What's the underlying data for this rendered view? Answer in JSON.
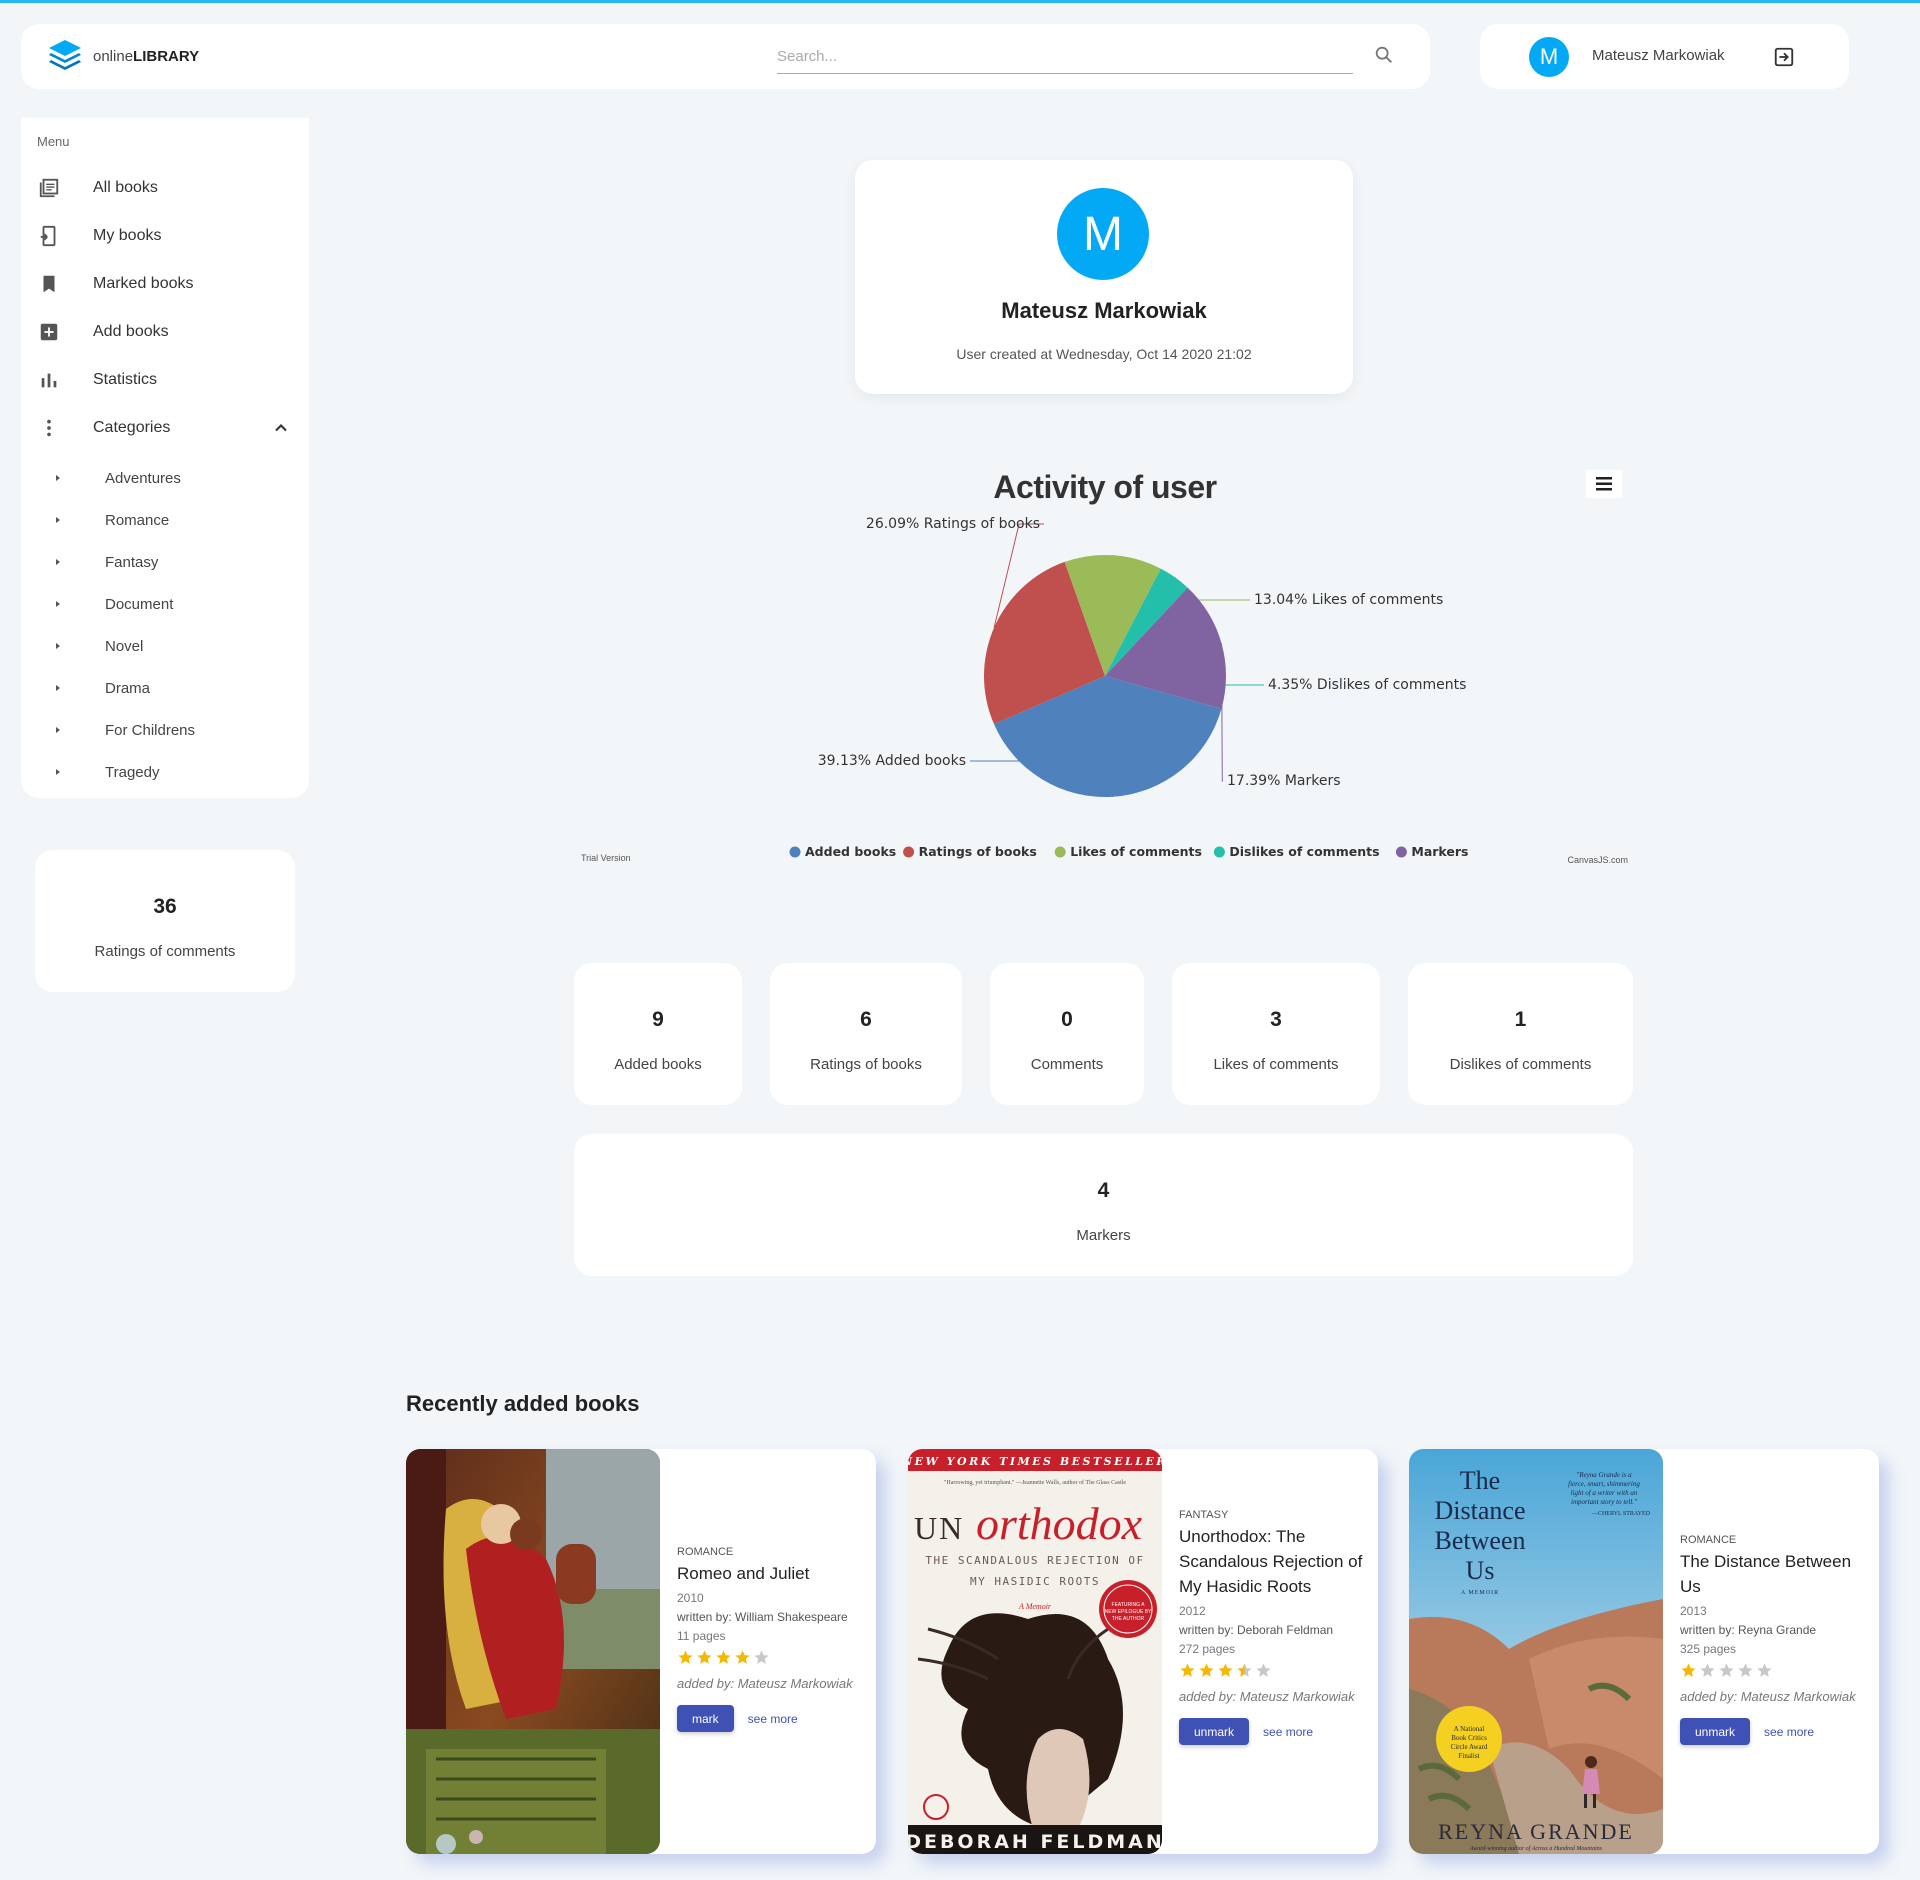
{
  "header": {
    "logo_prefix": "online",
    "logo_bold": "LIBRARY",
    "search_placeholder": "Search...",
    "user_initial": "M",
    "user_name": "Mateusz Markowiak"
  },
  "sidebar": {
    "menu_title": "Menu",
    "items": [
      {
        "label": "All books",
        "icon": "library-books-icon"
      },
      {
        "label": "My books",
        "icon": "phone-link-icon"
      },
      {
        "label": "Marked books",
        "icon": "bookmark-icon"
      },
      {
        "label": "Add books",
        "icon": "add-box-icon"
      },
      {
        "label": "Statistics",
        "icon": "bar-chart-icon"
      },
      {
        "label": "Categories",
        "icon": "more-vert-icon"
      }
    ],
    "categories": [
      "Adventures",
      "Romance",
      "Fantasy",
      "Document",
      "Novel",
      "Drama",
      "For Childrens",
      "Tragedy"
    ]
  },
  "side_stat": {
    "value": "36",
    "label": "Ratings of comments"
  },
  "profile": {
    "initial": "M",
    "name": "Mateusz Markowiak",
    "created": "User created at Wednesday, Oct 14 2020 21:02"
  },
  "chart_data": {
    "type": "pie",
    "title": "Activity of user",
    "slices": [
      {
        "name": "Added books",
        "percent": 39.13,
        "label": "39.13% Added books",
        "color": "#4f81bc"
      },
      {
        "name": "Ratings of books",
        "percent": 26.09,
        "label": "26.09% Ratings of books",
        "color": "#c0504e"
      },
      {
        "name": "Likes of comments",
        "percent": 13.04,
        "label": "13.04% Likes of comments",
        "color": "#9bbb58"
      },
      {
        "name": "Dislikes of comments",
        "percent": 4.35,
        "label": "4.35% Dislikes of comments",
        "color": "#23bfaa"
      },
      {
        "name": "Markers",
        "percent": 17.39,
        "label": "17.39% Markers",
        "color": "#8064a1"
      }
    ],
    "legend_placement": "bottom",
    "trial_text": "Trial Version",
    "credit_text": "CanvasJS.com"
  },
  "stats": [
    {
      "value": "9",
      "label": "Added books"
    },
    {
      "value": "6",
      "label": "Ratings of books"
    },
    {
      "value": "0",
      "label": "Comments"
    },
    {
      "value": "3",
      "label": "Likes of comments"
    },
    {
      "value": "1",
      "label": "Dislikes of comments"
    }
  ],
  "markers_stat": {
    "value": "4",
    "label": "Markers"
  },
  "recent": {
    "title": "Recently added books",
    "books": [
      {
        "category": "ROMANCE",
        "title": "Romeo and Juliet",
        "year": "2010",
        "author": "written by: William Shakespeare",
        "pages": "11 pages",
        "rating": 4,
        "added_by": "added by: Mateusz Markowiak",
        "action": "mark",
        "see_more": "see more"
      },
      {
        "category": "FANTASY",
        "title": "Unorthodox: The Scandalous Rejection of My Hasidic Roots",
        "year": "2012",
        "author": "written by: Deborah Feldman",
        "pages": "272 pages",
        "rating": 3.5,
        "added_by": "added by: Mateusz Markowiak",
        "action": "unmark",
        "see_more": "see more",
        "cover": {
          "banner": "NEW YORK TIMES BESTSELLER",
          "quote": "\"Harrowing, yet triumphant.\" —Jeannette Walls, author of The Glass Castle",
          "title_un": "UN",
          "title_rest": "orthodox",
          "subtitle1": "THE SCANDALOUS REJECTION OF",
          "subtitle2": "MY HASIDIC ROOTS",
          "memoir": "A Memoir",
          "badge": "FEATURING A NEW EPILOGUE BY THE AUTHOR",
          "author": "DEBORAH FELDMAN"
        }
      },
      {
        "category": "ROMANCE",
        "title": "The Distance Between Us",
        "year": "2013",
        "author": "written by: Reyna Grande",
        "pages": "325 pages",
        "rating": 1,
        "added_by": "added by: Mateusz Markowiak",
        "action": "unmark",
        "see_more": "see more",
        "cover": {
          "title": "The Distance Between Us",
          "memoir": "A MEMOIR",
          "quote": "\"Reyna Grande is a fierce, smart, shimmering light of a writer with an important story to tell.\" —CHERYL STRAYED",
          "badge": "A National Book Critics Circle Award Finalist",
          "author": "REYNA GRANDE",
          "footer": "Award-winning author of Across a Hundred Mountains"
        }
      }
    ]
  },
  "colors": {
    "accent": "#03a9f4",
    "button": "#3f51b5",
    "star": "#f5b800"
  }
}
